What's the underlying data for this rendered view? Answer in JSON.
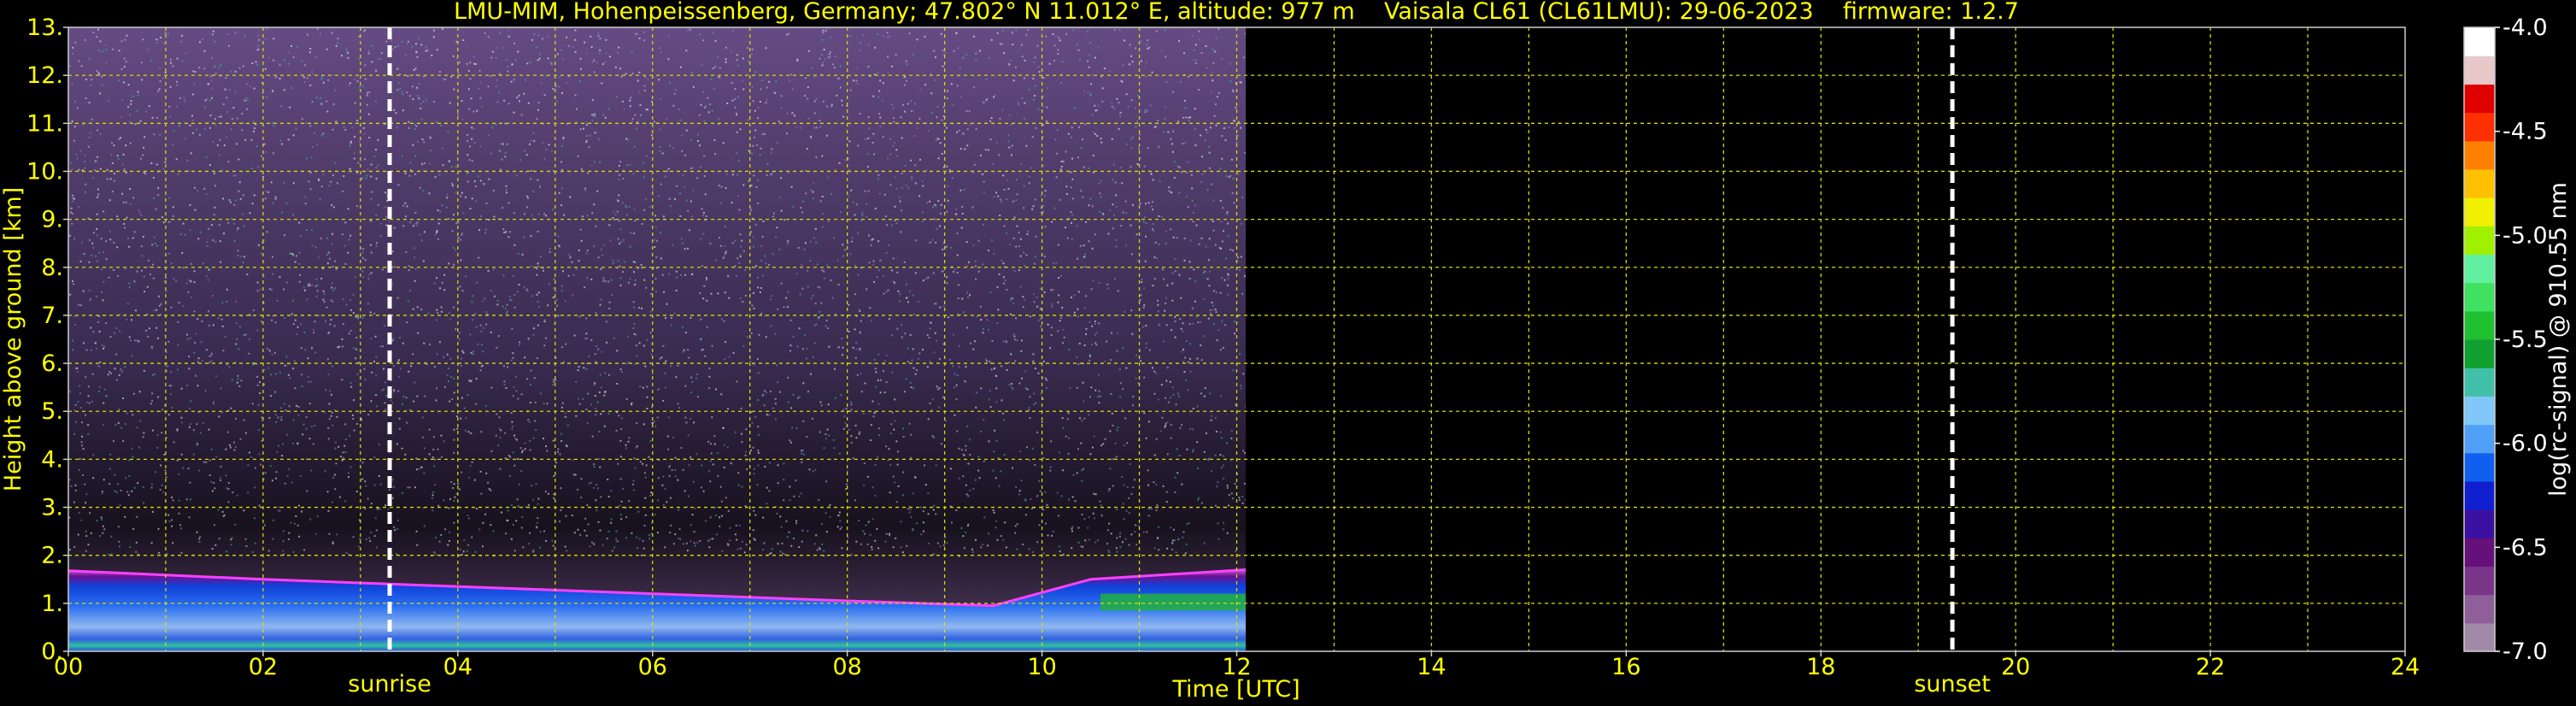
{
  "chart_data": {
    "type": "heatmap",
    "title": "LMU-MIM, Hohenpeissenberg, Germany; 47.802° N 11.012° E, altitude: 977 m    Vaisala CL61 (CL61LMU): 29-06-2023    firmware: 1.2.7",
    "xlabel": "Time [UTC]",
    "ylabel": "Height above ground [km]",
    "xlim": [
      0,
      24
    ],
    "ylim": [
      0,
      13
    ],
    "x_ticks": [
      "00",
      "02",
      "04",
      "06",
      "08",
      "10",
      "12",
      "14",
      "16",
      "18",
      "20",
      "22",
      "24"
    ],
    "y_ticks": [
      "0.",
      "1.",
      "2.",
      "3.",
      "4.",
      "5.",
      "6.",
      "7.",
      "8.",
      "9.",
      "10.",
      "11.",
      "12.",
      "13."
    ],
    "grid": true,
    "data_extent_hours": [
      0,
      12.1
    ],
    "sun_markers": [
      {
        "label": "sunrise",
        "time": 3.3
      },
      {
        "label": "sunset",
        "time": 19.35
      }
    ],
    "boundary_layer_top_km": [
      {
        "time": 0.0,
        "height": 1.68
      },
      {
        "time": 2.0,
        "height": 1.5
      },
      {
        "time": 4.0,
        "height": 1.35
      },
      {
        "time": 6.0,
        "height": 1.2
      },
      {
        "time": 8.0,
        "height": 1.05
      },
      {
        "time": 9.5,
        "height": 0.95
      },
      {
        "time": 10.5,
        "height": 1.5
      },
      {
        "time": 12.1,
        "height": 1.7
      }
    ],
    "colorbar": {
      "label": "log(rc-signal) @ 910.55 nm",
      "min": -7.0,
      "max": -4.0,
      "ticks": [
        "-4.0",
        "-4.5",
        "-5.0",
        "-5.5",
        "-6.0",
        "-6.5",
        "-7.0"
      ],
      "colors": [
        "#a08aa8",
        "#8e5f98",
        "#7a3488",
        "#66107a",
        "#3a10a0",
        "#1020d0",
        "#1060f0",
        "#50a0f8",
        "#80c8f8",
        "#40c0a8",
        "#10a030",
        "#20c030",
        "#40e060",
        "#60f0a0",
        "#a0f000",
        "#f0f000",
        "#ffc000",
        "#ff8000",
        "#ff3000",
        "#e00000",
        "#e8c8c8",
        "#ffffff"
      ]
    }
  }
}
